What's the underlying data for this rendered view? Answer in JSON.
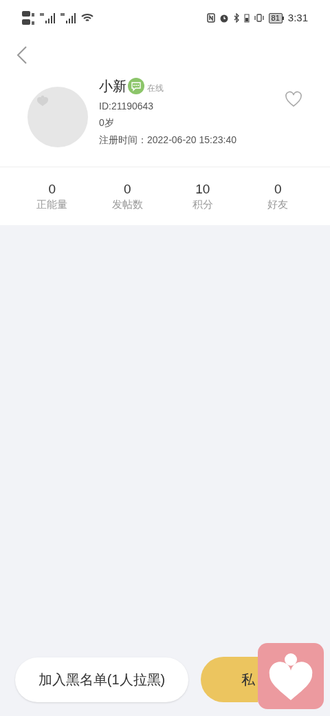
{
  "status_bar": {
    "battery": "81",
    "time": "3:31"
  },
  "profile": {
    "name": "小新",
    "status": "在线",
    "id": "ID:21190643",
    "age": "0岁",
    "registered": "注册时间：2022-06-20 15:23:40",
    "favorited": false
  },
  "stats": [
    {
      "value": "0",
      "label": "正能量"
    },
    {
      "value": "0",
      "label": "发帖数"
    },
    {
      "value": "10",
      "label": "积分"
    },
    {
      "value": "0",
      "label": "好友"
    }
  ],
  "actions": {
    "blacklist": "加入黑名单(1人拉黑)",
    "message": "私"
  }
}
